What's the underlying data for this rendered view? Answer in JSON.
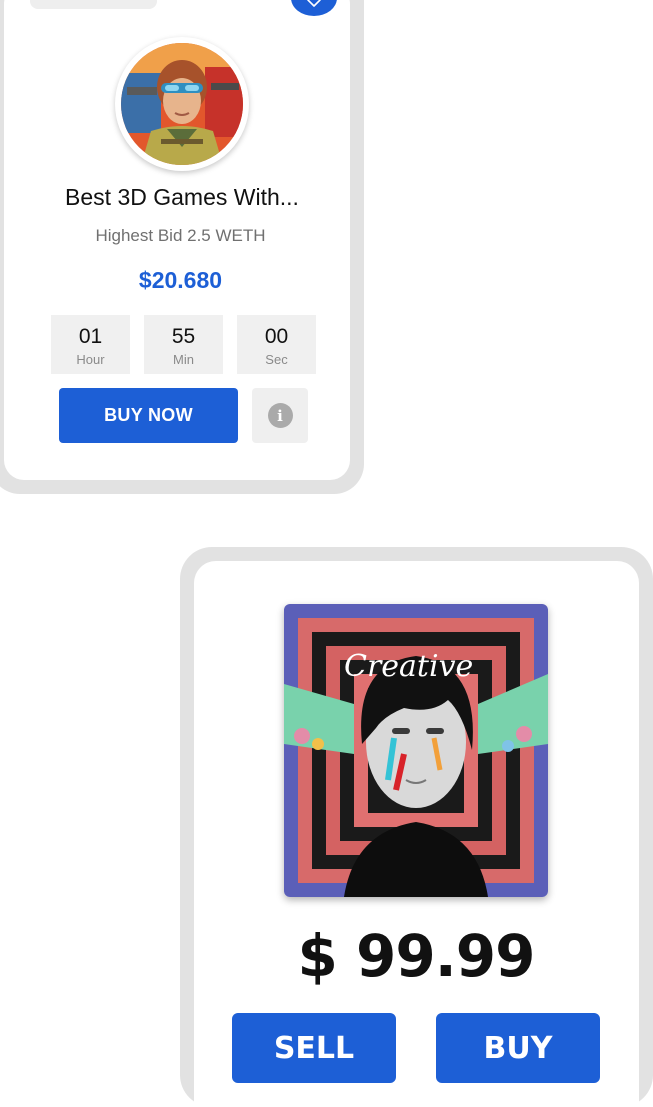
{
  "auction_card": {
    "title": "Best 3D Games With...",
    "subtitle": "Highest Bid 2.5 WETH",
    "price": "$20.680",
    "countdown": [
      {
        "value": "01",
        "unit": "Hour"
      },
      {
        "value": "55",
        "unit": "Min"
      },
      {
        "value": "00",
        "unit": "Sec"
      }
    ],
    "buy_label": "BUY NOW",
    "info_icon": "info-icon",
    "wishlist_icon": "heart-icon",
    "avatar": "game-character-avatar"
  },
  "art_card": {
    "artwork": "creative-portrait-artwork",
    "artwork_text": "Creative",
    "price": "$ 99.99",
    "sell_label": "SELL",
    "buy_label": "BUY"
  },
  "colors": {
    "accent": "#1d5fd6",
    "card_border": "#e2e2e2",
    "timer_bg": "#f0f0f0"
  }
}
